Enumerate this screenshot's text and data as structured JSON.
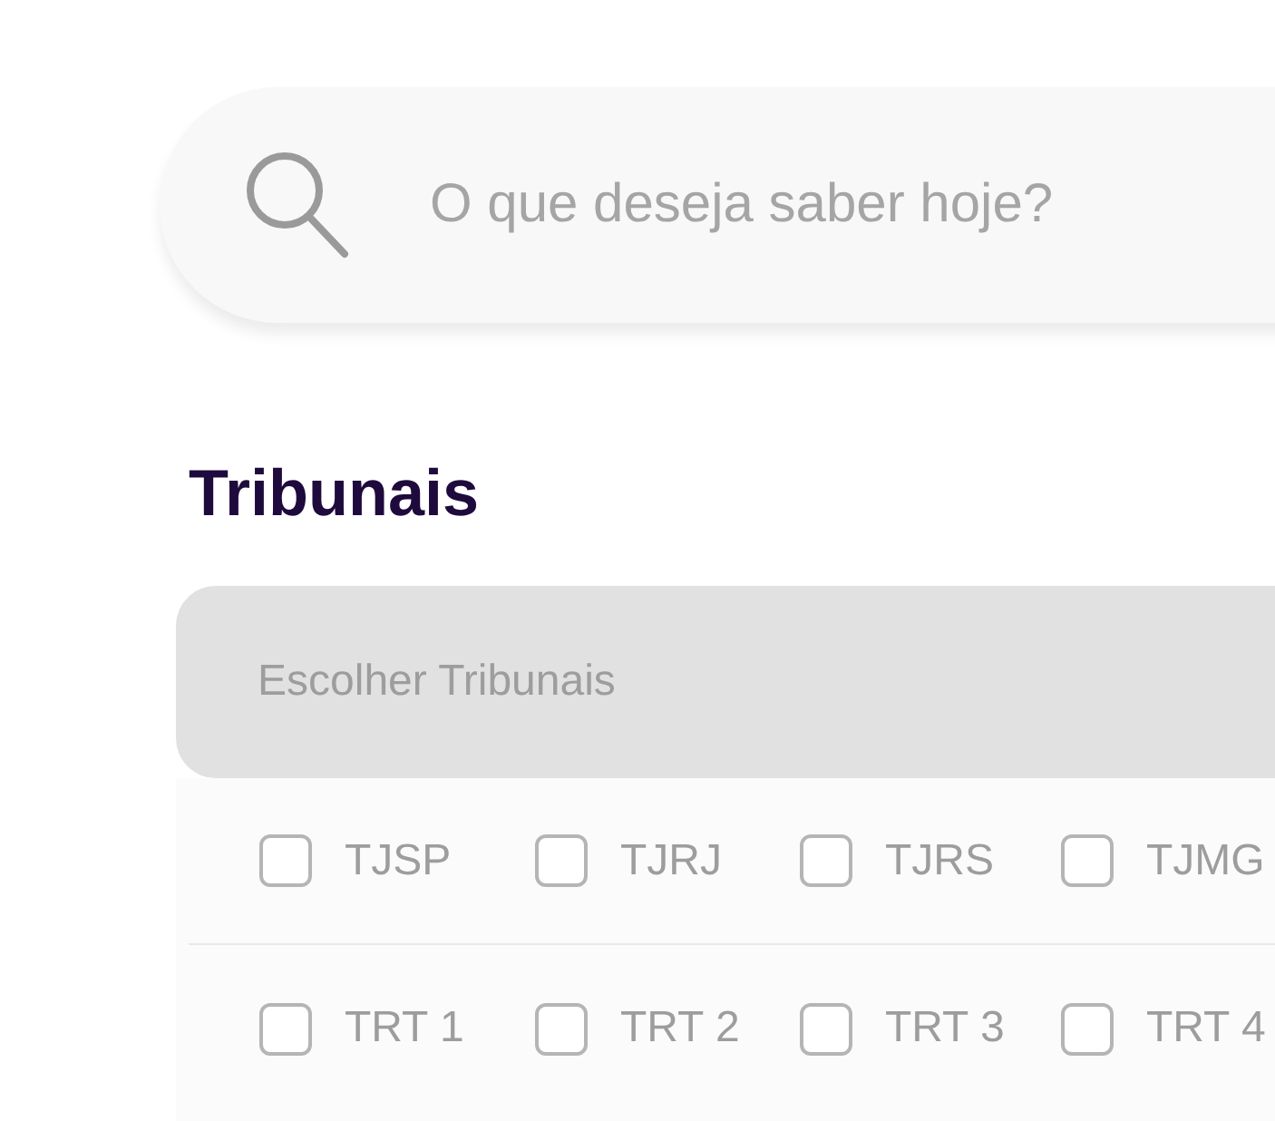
{
  "search": {
    "placeholder": "O que deseja saber hoje?"
  },
  "section_title": "Tribunais",
  "dropdown": {
    "label": "Escolher Tribunais"
  },
  "option_rows": [
    [
      {
        "label": "TJSP",
        "checked": false
      },
      {
        "label": "TJRJ",
        "checked": false
      },
      {
        "label": "TJRS",
        "checked": false
      },
      {
        "label": "TJMG",
        "checked": false
      }
    ],
    [
      {
        "label": "TRT 1",
        "checked": false
      },
      {
        "label": "TRT 2",
        "checked": false
      },
      {
        "label": "TRT 3",
        "checked": false
      },
      {
        "label": "TRT 4",
        "checked": false
      }
    ]
  ]
}
